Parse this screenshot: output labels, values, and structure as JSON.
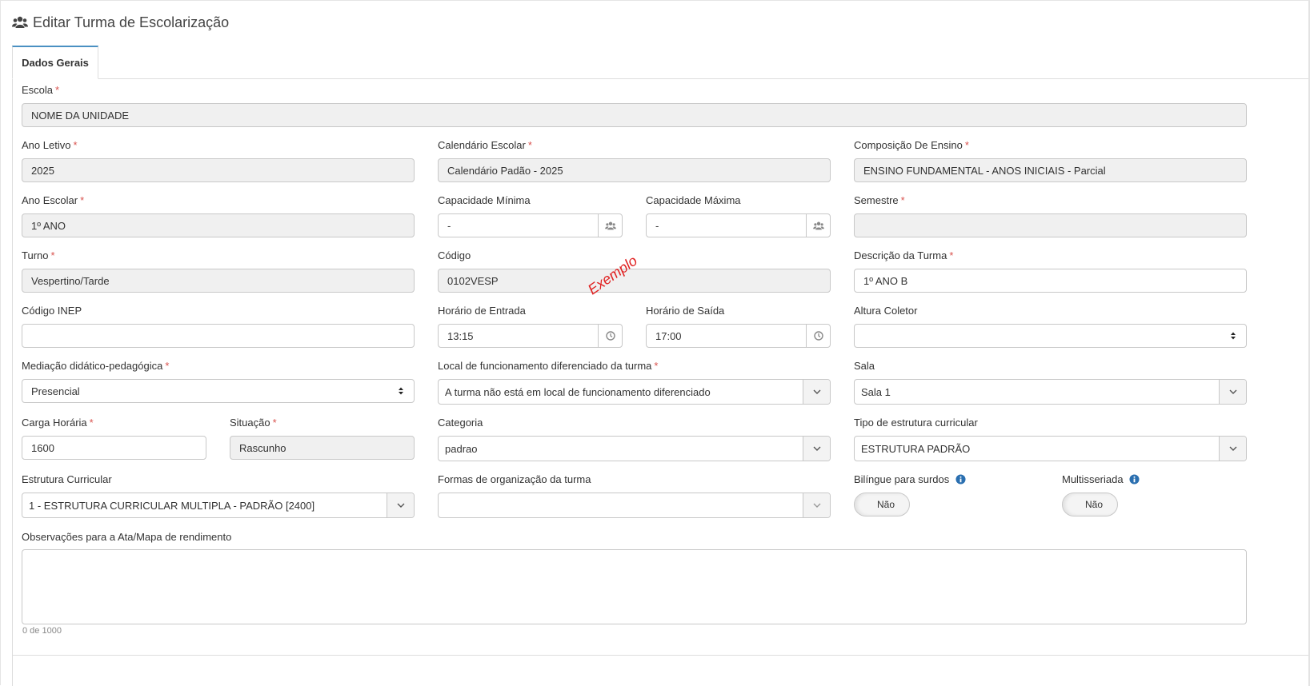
{
  "header": {
    "title": "Editar Turma de Escolarização",
    "icon": "users-icon"
  },
  "tabs": [
    {
      "label": "Dados Gerais",
      "active": true
    }
  ],
  "required_marker": "*",
  "fields": {
    "escola": {
      "label": "Escola",
      "value": "NOME DA UNIDADE"
    },
    "ano_letivo": {
      "label": "Ano Letivo",
      "value": "2025"
    },
    "calendario": {
      "label": "Calendário Escolar",
      "value": "Calendário Padão - 2025"
    },
    "composicao": {
      "label": "Composição De Ensino",
      "value": "ENSINO FUNDAMENTAL - ANOS INICIAIS - Parcial"
    },
    "ano_escolar": {
      "label": "Ano Escolar",
      "value": "1º ANO"
    },
    "cap_min": {
      "label": "Capacidade Mínima",
      "value": "-"
    },
    "cap_max": {
      "label": "Capacidade Máxima",
      "value": "-"
    },
    "semestre": {
      "label": "Semestre",
      "value": ""
    },
    "turno": {
      "label": "Turno",
      "value": "Vespertino/Tarde"
    },
    "codigo": {
      "label": "Código",
      "value": "0102VESP"
    },
    "descricao": {
      "label": "Descrição da Turma",
      "value": "1º ANO B"
    },
    "inep": {
      "label": "Código INEP",
      "value": ""
    },
    "entrada": {
      "label": "Horário de Entrada",
      "value": "13:15"
    },
    "saida": {
      "label": "Horário de Saída",
      "value": "17:00"
    },
    "altura": {
      "label": "Altura Coletor",
      "value": ""
    },
    "mediacao": {
      "label": "Mediação didático-pedagógica",
      "value": "Presencial"
    },
    "local": {
      "label": "Local de funcionamento diferenciado da turma",
      "value": "A turma não está em local de funcionamento diferenciado"
    },
    "sala": {
      "label": "Sala",
      "value": "Sala 1"
    },
    "carga": {
      "label": "Carga Horária",
      "value": "1600"
    },
    "situacao": {
      "label": "Situação",
      "value": "Rascunho"
    },
    "categoria": {
      "label": "Categoria",
      "value": "padrao"
    },
    "tipo_estrutura": {
      "label": "Tipo de estrutura curricular",
      "value": "ESTRUTURA PADRÃO"
    },
    "estrutura": {
      "label": "Estrutura Curricular",
      "value": "1 - ESTRUTURA CURRICULAR MULTIPLA - PADRÃO [2400]"
    },
    "formas": {
      "label": "Formas de organização da turma",
      "value": ""
    },
    "bilingue": {
      "label": "Bilíngue para surdos",
      "value": "Não"
    },
    "multisseriada": {
      "label": "Multisseriada",
      "value": "Não"
    },
    "observacoes": {
      "label": "Observações para a Ata/Mapa de rendimento",
      "value": "",
      "counter": "0 de 1000"
    }
  },
  "annotation": "Exemplo",
  "colors": {
    "required": "#d9534f",
    "tab_accent": "#4a90c2",
    "readonly_bg": "#f0f0f0",
    "info_icon": "#2a6fb0",
    "annotation": "#e02020"
  }
}
